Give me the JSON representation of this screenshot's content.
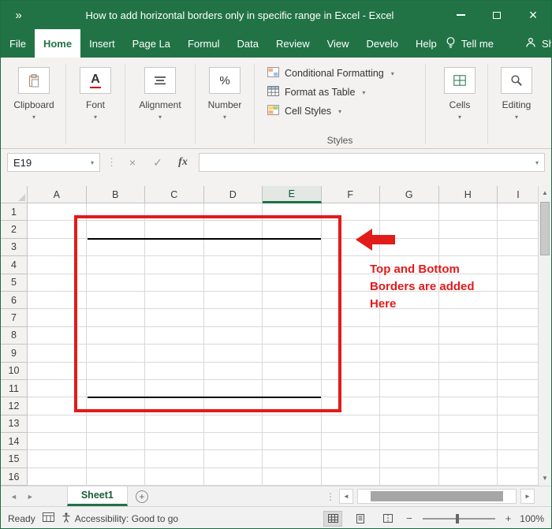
{
  "window": {
    "title": "How to add horizontal borders only in specific range in Excel  -  Excel",
    "pin": "»",
    "controls": {
      "close": "×"
    }
  },
  "icons": {
    "up": "▲",
    "down": "▼",
    "left": "◄",
    "right": "►",
    "chevron_down": "▾",
    "dots": "⋮",
    "cancel": "×",
    "check": "✓"
  },
  "ribbon": {
    "tabs": [
      {
        "label": "File"
      },
      {
        "label": "Home"
      },
      {
        "label": "Insert"
      },
      {
        "label": "Page La"
      },
      {
        "label": "Formul"
      },
      {
        "label": "Data"
      },
      {
        "label": "Review"
      },
      {
        "label": "View"
      },
      {
        "label": "Develo"
      },
      {
        "label": "Help"
      }
    ],
    "active_tab": "Home",
    "tell_me": "Tell me",
    "share": "Share",
    "groups": [
      {
        "label": "Clipboard"
      },
      {
        "label": "Font"
      },
      {
        "label": "Alignment"
      },
      {
        "label": "Number"
      },
      {
        "label": "Cells"
      },
      {
        "label": "Editing"
      }
    ],
    "styles": {
      "label": "Styles",
      "items": [
        "Conditional Formatting",
        "Format as Table",
        "Cell Styles"
      ]
    }
  },
  "formula_bar": {
    "name_box": "E19",
    "fx_label": "fx",
    "formula_value": ""
  },
  "grid": {
    "columns": [
      "A",
      "B",
      "C",
      "D",
      "E",
      "F",
      "G",
      "H",
      "I"
    ],
    "selected_column": "E",
    "row_count": 16
  },
  "annotation": {
    "color": "#e21b1b",
    "lines": [
      "Top and Bottom",
      "Borders are added",
      "Here"
    ]
  },
  "sheet_bar": {
    "tabs": [
      {
        "name": "Sheet1",
        "active": true
      }
    ],
    "new_sheet": "+"
  },
  "status_bar": {
    "mode": "Ready",
    "accessibility": "Accessibility: Good to go",
    "zoom_level": "100%"
  }
}
